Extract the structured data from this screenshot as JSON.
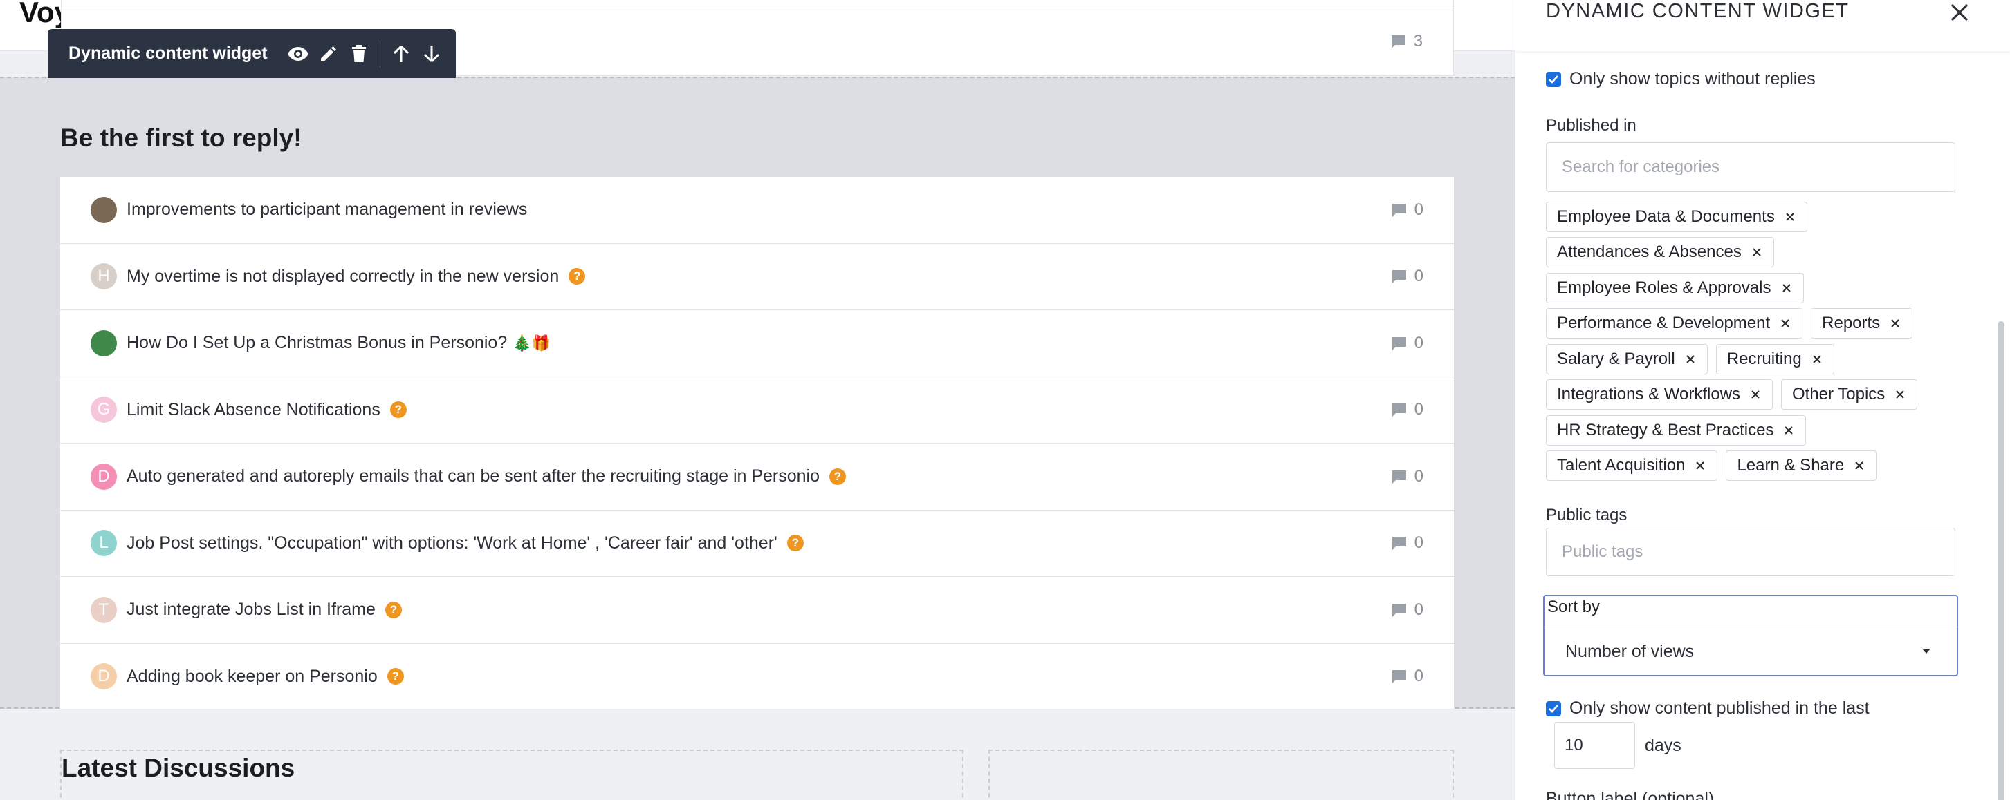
{
  "page": {
    "partial_title": "Voy",
    "top_reply_count": "3"
  },
  "toolbar": {
    "label": "Dynamic content widget",
    "icons": [
      "eye-icon",
      "pencil-icon",
      "trash-icon",
      "arrow-up-icon",
      "arrow-down-icon"
    ]
  },
  "section": {
    "title": "Be the first to reply!",
    "topics": [
      {
        "title": "Improvements to participant management in reviews",
        "replies": "0",
        "avatar_letter": "",
        "avatar_color": "#7a6a55",
        "question": false,
        "emoji": ""
      },
      {
        "title": "My overtime is not displayed correctly in the new version",
        "replies": "0",
        "avatar_letter": "H",
        "avatar_color": "#d9cfc9",
        "question": true,
        "emoji": ""
      },
      {
        "title": "How Do I Set Up a Christmas Bonus in Personio?",
        "replies": "0",
        "avatar_letter": "",
        "avatar_color": "#3f8a4a",
        "question": false,
        "emoji": "🎄🎁"
      },
      {
        "title": "Limit Slack Absence Notifications",
        "replies": "0",
        "avatar_letter": "G",
        "avatar_color": "#f6c7da",
        "question": true,
        "emoji": ""
      },
      {
        "title": "Auto generated and autoreply emails that can be sent after the recruiting stage in Personio",
        "replies": "0",
        "avatar_letter": "D",
        "avatar_color": "#f38fb4",
        "question": true,
        "emoji": ""
      },
      {
        "title": "Job Post settings. \"Occupation\" with options: 'Work at Home' , 'Career fair' and 'other'",
        "replies": "0",
        "avatar_letter": "L",
        "avatar_color": "#8fd3cf",
        "question": true,
        "emoji": ""
      },
      {
        "title": "Just integrate Jobs List in Iframe",
        "replies": "0",
        "avatar_letter": "T",
        "avatar_color": "#e9cfc6",
        "question": true,
        "emoji": ""
      },
      {
        "title": "Adding book keeper on Personio",
        "replies": "0",
        "avatar_letter": "D",
        "avatar_color": "#f5cfa9",
        "question": true,
        "emoji": ""
      }
    ]
  },
  "latest": {
    "title": "Latest Discussions"
  },
  "panel": {
    "title": "DYNAMIC CONTENT WIDGET",
    "only_no_replies_label": "Only show topics without replies",
    "published_in_label": "Published in",
    "categories_placeholder": "Search for categories",
    "categories": [
      "Employee Data & Documents",
      "Attendances & Absences",
      "Employee Roles & Approvals",
      "Performance & Development",
      "Reports",
      "Salary & Payroll",
      "Recruiting",
      "Integrations & Workflows",
      "Other Topics",
      "HR Strategy & Best Practices",
      "Talent Acquisition",
      "Learn & Share"
    ],
    "public_tags_label": "Public tags",
    "public_tags_placeholder": "Public tags",
    "sort_by_label": "Sort by",
    "sort_by_value": "Number of views",
    "only_recent_label": "Only show content published in the last",
    "days_value": "10",
    "days_unit": "days",
    "button_label_label": "Button label (optional)"
  },
  "colors": {
    "accent": "#1a6fe0",
    "question_badge": "#ee9620",
    "toolbar_bg": "#2c3444",
    "focus_border": "#6b7fd6"
  }
}
